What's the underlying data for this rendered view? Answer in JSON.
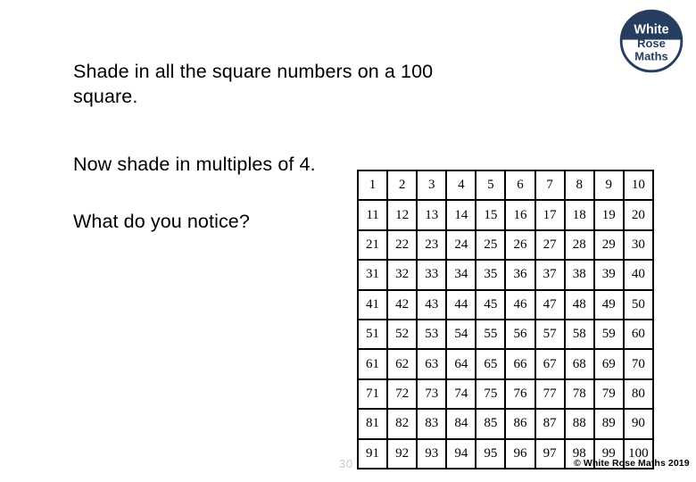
{
  "slide": {
    "page_number": "30",
    "copyright": "© White Rose Maths 2019"
  },
  "logo": {
    "name": "white-rose-maths-logo",
    "line1": "White",
    "line2": "Rose",
    "line3": "Maths",
    "navy": "#263D5F",
    "white": "#FFFFFF"
  },
  "content": {
    "line1": "Shade in all the square numbers on a 100",
    "line2": "square.",
    "line3": "Now shade in multiples of 4.",
    "line4": "What do you notice?"
  },
  "hundred_square": {
    "title": "100 square",
    "rows": [
      [
        "1",
        "2",
        "3",
        "4",
        "5",
        "6",
        "7",
        "8",
        "9",
        "10"
      ],
      [
        "11",
        "12",
        "13",
        "14",
        "15",
        "16",
        "17",
        "18",
        "19",
        "20"
      ],
      [
        "21",
        "22",
        "23",
        "24",
        "25",
        "26",
        "27",
        "28",
        "29",
        "30"
      ],
      [
        "31",
        "32",
        "33",
        "34",
        "35",
        "36",
        "37",
        "38",
        "39",
        "40"
      ],
      [
        "41",
        "42",
        "43",
        "44",
        "45",
        "46",
        "47",
        "48",
        "49",
        "50"
      ],
      [
        "51",
        "52",
        "53",
        "54",
        "55",
        "56",
        "57",
        "58",
        "59",
        "60"
      ],
      [
        "61",
        "62",
        "63",
        "64",
        "65",
        "66",
        "67",
        "68",
        "69",
        "70"
      ],
      [
        "71",
        "72",
        "73",
        "74",
        "75",
        "76",
        "77",
        "78",
        "79",
        "80"
      ],
      [
        "81",
        "82",
        "83",
        "84",
        "85",
        "86",
        "87",
        "88",
        "89",
        "90"
      ],
      [
        "91",
        "92",
        "93",
        "94",
        "95",
        "96",
        "97",
        "98",
        "99",
        "100"
      ]
    ]
  }
}
